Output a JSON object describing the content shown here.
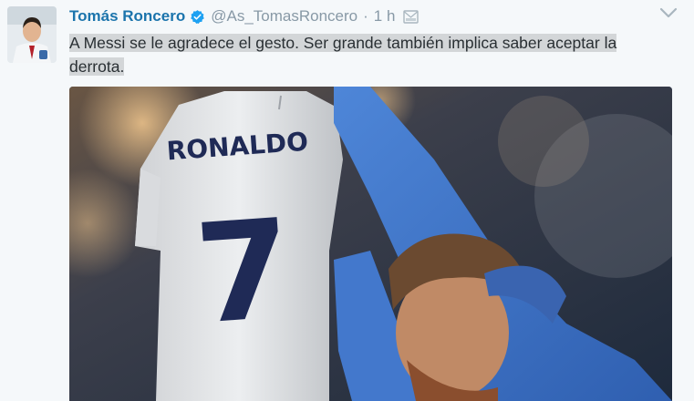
{
  "tweet": {
    "author_name": "Tomás Roncero",
    "handle": "@As_TomasRoncero",
    "separator": "·",
    "time": "1 h",
    "text_line1": "A Messi se le agradece el gesto. Ser grande también implica saber aceptar la",
    "text_line2": "derrota.",
    "jersey_name": "RONALDO",
    "jersey_number": "7"
  },
  "icons": {
    "verified": "verified-badge-icon",
    "dm": "direct-message-icon",
    "menu": "chevron-down-icon"
  },
  "colors": {
    "name": "#1b74ac",
    "muted": "#8899a6",
    "text": "#292f33",
    "highlight": "#d3d6d8",
    "background": "#f5f8fa",
    "verified": "#1da1f2"
  }
}
